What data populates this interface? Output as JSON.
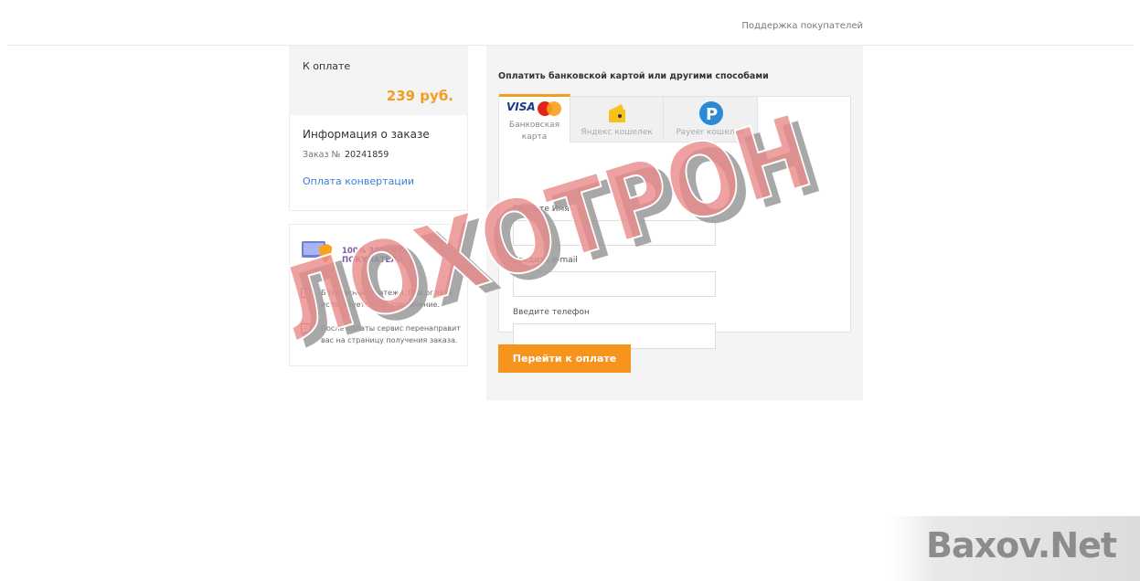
{
  "header": {
    "support_link": "Поддержка покупателей"
  },
  "summary": {
    "amount_label": "К оплате",
    "amount_value": "239 руб.",
    "order_info_title": "Информация о заказе",
    "order_number_label": "Заказ №",
    "order_number": "20241859",
    "order_link": "Оплата конвертации"
  },
  "protection": {
    "title": "100% ЗАЩИТА ПОКУПАТЕЛЯ",
    "items": [
      "Безопасные платежи. При оплате используется SSL соединение.",
      "После оплаты сервис перенаправит вас на страницу получения заказа."
    ]
  },
  "payment": {
    "heading": "Оплатить банковской картой или другими способами",
    "tabs": [
      {
        "label": "Банковская карта",
        "logo": "VISA"
      },
      {
        "label": "Яндекс кошелек"
      },
      {
        "label": "Payeer кошелек"
      }
    ],
    "fields": {
      "name_label": "Введите Имя",
      "name_value": "",
      "email_label": "Введите e-mail",
      "email_value": "",
      "phone_label": "Введите телефон",
      "phone_value": ""
    },
    "submit_label": "Перейти к оплате"
  },
  "watermarks": {
    "stamp": "ЛОХОТРОН",
    "site": "Baxov.Net"
  },
  "colors": {
    "accent": "#f7941d",
    "price": "#f39c1f",
    "link": "#3b7fd6",
    "stamp": "#e88a8a"
  },
  "icons": {
    "mastercard": "mastercard-icon",
    "yandex": "yandex-wallet-icon",
    "payeer": "payeer-icon",
    "shield": "shield-icon",
    "checkbox": "check-icon"
  }
}
